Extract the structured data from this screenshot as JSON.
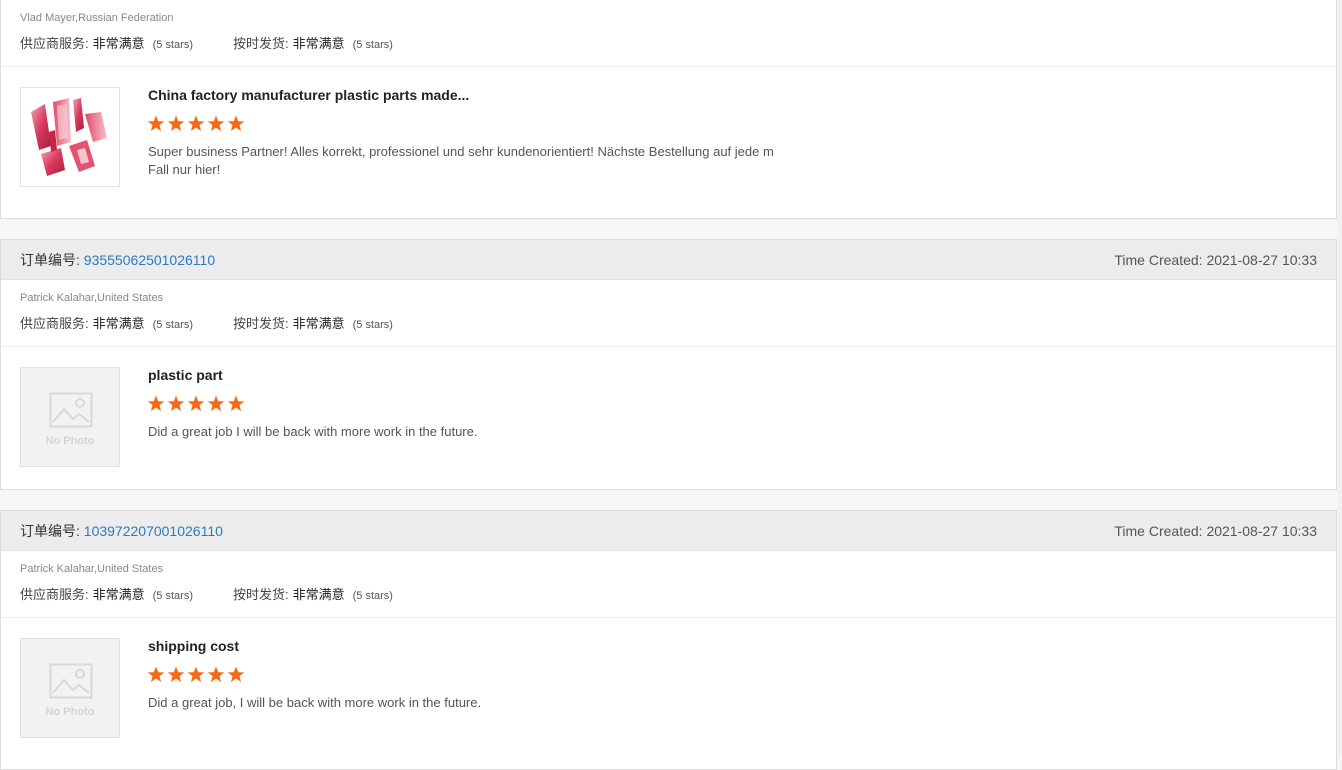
{
  "labels": {
    "order_no": "订单编号:",
    "time_created": "Time Created:",
    "supplier_service": "供应商服务:",
    "on_time_delivery": "按时发货:",
    "no_photo": "No Photo"
  },
  "colors": {
    "star": "#f56a15",
    "link": "#2a7ac3"
  },
  "reviews": [
    {
      "buyer": "Vlad Mayer,Russian Federation",
      "supplier_service_value": "非常满意",
      "supplier_service_stars": "(5 stars)",
      "delivery_value": "非常满意",
      "delivery_stars": "(5 stars)",
      "product_title": "China factory manufacturer plastic parts made...",
      "product_image": "plastic-parts-photo",
      "rating": 5,
      "text": "Super business Partner! Alles korrekt, professionel und sehr kundenorientiert! Nächste Bestellung auf jede m Fall nur hier!"
    },
    {
      "order_no": "93555062501026110",
      "time_created": "2021-08-27 10:33",
      "buyer": "Patrick Kalahar,United States",
      "supplier_service_value": "非常满意",
      "supplier_service_stars": "(5 stars)",
      "delivery_value": "非常满意",
      "delivery_stars": "(5 stars)",
      "product_title": "plastic part",
      "product_image": "no-photo",
      "rating": 5,
      "text": "Did a great job I will be back with more work in the future."
    },
    {
      "order_no": "103972207001026110",
      "time_created": "2021-08-27 10:33",
      "buyer": "Patrick Kalahar,United States",
      "supplier_service_value": "非常满意",
      "supplier_service_stars": "(5 stars)",
      "delivery_value": "非常满意",
      "delivery_stars": "(5 stars)",
      "product_title": "shipping cost",
      "product_image": "no-photo",
      "rating": 5,
      "text": "Did a great job, I will be back with more work in the future."
    }
  ]
}
